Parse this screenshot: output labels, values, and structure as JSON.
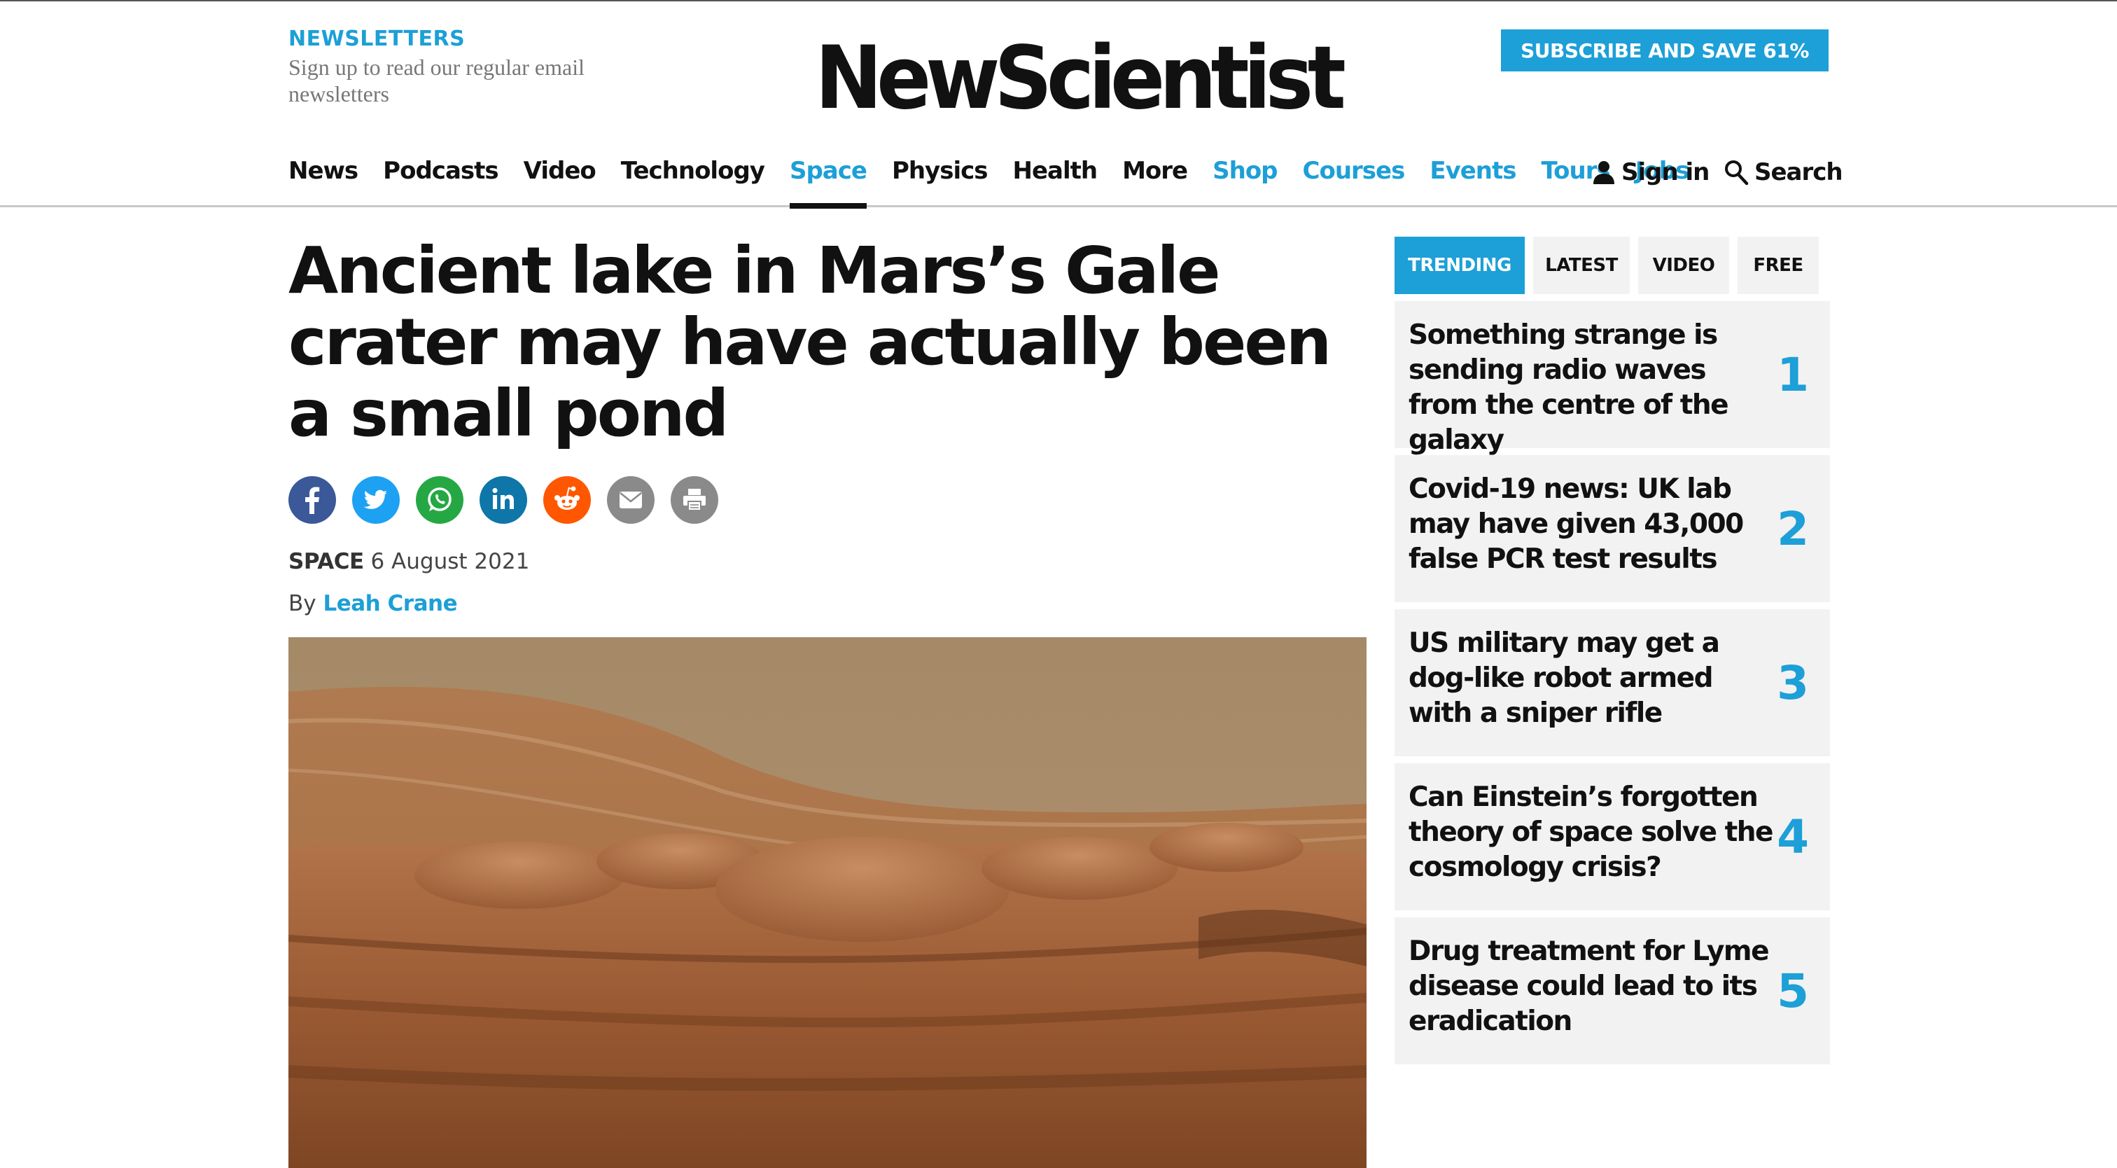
{
  "header": {
    "newsletters_title": "NEWSLETTERS",
    "newsletters_desc": "Sign up to read our regular email newsletters",
    "logo": "NewScientist",
    "subscribe_label": "SUBSCRIBE AND SAVE 61%",
    "signin_label": "Sign in",
    "search_label": "Search"
  },
  "nav": {
    "items": [
      {
        "label": "News",
        "color": "#111111"
      },
      {
        "label": "Podcasts",
        "color": "#111111"
      },
      {
        "label": "Video",
        "color": "#111111"
      },
      {
        "label": "Technology",
        "color": "#111111"
      },
      {
        "label": "Space",
        "color": "#1d9fd7",
        "active": true
      },
      {
        "label": "Physics",
        "color": "#111111"
      },
      {
        "label": "Health",
        "color": "#111111"
      },
      {
        "label": "More",
        "color": "#111111"
      },
      {
        "label": "Shop",
        "color": "#1d9fd7"
      },
      {
        "label": "Courses",
        "color": "#1d9fd7"
      },
      {
        "label": "Events",
        "color": "#1d9fd7"
      },
      {
        "label": "Tours",
        "color": "#1d9fd7"
      },
      {
        "label": "Jobs",
        "color": "#1d9fd7"
      }
    ]
  },
  "article": {
    "headline": "Ancient lake in Mars’s Gale crater may have actually been a small pond",
    "section": "SPACE",
    "date": "6 August 2021",
    "by_prefix": "By",
    "author": "Leah Crane",
    "share_icons": [
      "facebook-icon",
      "twitter-icon",
      "whatsapp-icon",
      "linkedin-icon",
      "reddit-icon",
      "email-icon",
      "print-icon"
    ]
  },
  "sidebar": {
    "tabs": [
      {
        "label": "TRENDING",
        "active": true
      },
      {
        "label": "LATEST"
      },
      {
        "label": "VIDEO"
      },
      {
        "label": "FREE"
      }
    ],
    "trending": [
      {
        "title": "Something strange is sending radio waves from the centre of the galaxy",
        "rank": "1"
      },
      {
        "title": "Covid-19 news: UK lab may have given 43,000 false PCR test results",
        "rank": "2"
      },
      {
        "title": "US military may get a dog-like robot armed with a sniper rifle",
        "rank": "3"
      },
      {
        "title": "Can Einstein’s forgotten theory of space solve the cosmology crisis?",
        "rank": "4"
      },
      {
        "title": "Drug treatment for Lyme disease could lead to its eradication",
        "rank": "5"
      }
    ]
  },
  "colors": {
    "accent": "#1d9fd7",
    "tab_bg": "#f2f2f2"
  }
}
